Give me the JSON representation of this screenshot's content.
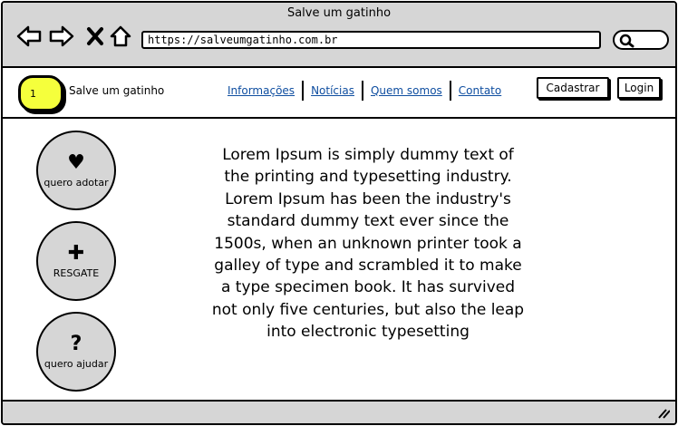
{
  "window": {
    "title": "Salve um gatinho"
  },
  "toolbar": {
    "back_icon": "arrow-left-icon",
    "forward_icon": "arrow-right-icon",
    "stop_icon": "close-icon",
    "home_icon": "home-icon",
    "url": "https://salveumgatinho.com.br",
    "search_icon": "search-icon"
  },
  "header": {
    "logo_text": "1",
    "logo_color": "#f5ff3c",
    "site_name": "Salve um gatinho",
    "menu": [
      {
        "label": "Informações"
      },
      {
        "label": "Notícias"
      },
      {
        "label": "Quem somos"
      },
      {
        "label": "Contato"
      }
    ],
    "link_color": "#0f4ea0",
    "register_label": "Cadastrar",
    "login_label": "Login"
  },
  "actions": [
    {
      "icon_name": "heart-icon",
      "icon": "♥",
      "label": "quero adotar"
    },
    {
      "icon_name": "plus-icon",
      "icon": "✚",
      "label": "RESGATE"
    },
    {
      "icon_name": "question-icon",
      "icon": "?",
      "label": "quero ajudar"
    }
  ],
  "main": {
    "text": "Lorem Ipsum is simply dummy text of the printing and typesetting industry. Lorem Ipsum has been the industry's standard dummy text ever since the 1500s, when an unknown printer took a galley of type and scrambled it to make a type specimen book. It has survived not only five centuries, but also the leap into electronic typesetting"
  }
}
